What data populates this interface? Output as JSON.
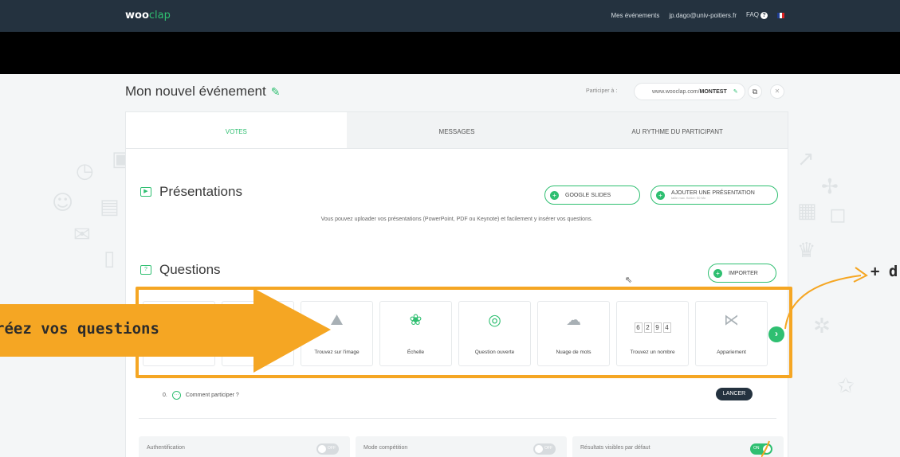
{
  "topbar": {
    "logo_bold": "woo",
    "logo_light": "clap",
    "nav": [
      "Mes événements",
      "jp.dago@univ-poitiers.fr",
      "FAQ"
    ]
  },
  "event": {
    "title": "Mon nouvel événement",
    "participer_label": "Participer à :",
    "url_prefix": "www.wooclap.com/",
    "url_code": "MONTEST"
  },
  "tabs": [
    "VOTES",
    "MESSAGES",
    "AU RYTHME DU PARTICIPANT"
  ],
  "presentations": {
    "title": "Présentations",
    "google_slides": "GOOGLE SLIDES",
    "add_presentation": "AJOUTER UNE PRÉSENTATION",
    "add_presentation_sub": "taille max. fichier: 50 Mo",
    "helper": "Vous pouvez uploader vos présentations (PowerPoint, PDF ou Keynote) et facilement y insérer vos questions."
  },
  "questions": {
    "title": "Questions",
    "import": "IMPORTER",
    "types": [
      {
        "label": "",
        "icon": "blank"
      },
      {
        "label": "",
        "icon": "blank"
      },
      {
        "label": "Trouvez sur l'image",
        "icon": "image-icon"
      },
      {
        "label": "Échelle",
        "icon": "ribbon-icon"
      },
      {
        "label": "Question ouverte",
        "icon": "speech-bubble-icon"
      },
      {
        "label": "Nuage de mots",
        "icon": "cloud-icon"
      },
      {
        "label": "Trouvez un nombre",
        "icon": "number-boxes-icon"
      },
      {
        "label": "Appariement",
        "icon": "matching-icon"
      }
    ],
    "number_digits": [
      "6",
      "2",
      "9",
      "4"
    ],
    "list": [
      {
        "index": "0.",
        "text": "Comment participer ?",
        "action": "LANCER"
      }
    ]
  },
  "settings": [
    {
      "label": "Authentification",
      "state": "OFF"
    },
    {
      "label": "Mode compétition",
      "state": "OFF"
    },
    {
      "label": "Résultats visibles par défaut",
      "state": "ON"
    }
  ],
  "annotations": {
    "left": "réez vos questions",
    "right": "+ d"
  },
  "colors": {
    "accent": "#2fbf71",
    "annotation": "#f5a623",
    "topbar": "#24323f"
  }
}
